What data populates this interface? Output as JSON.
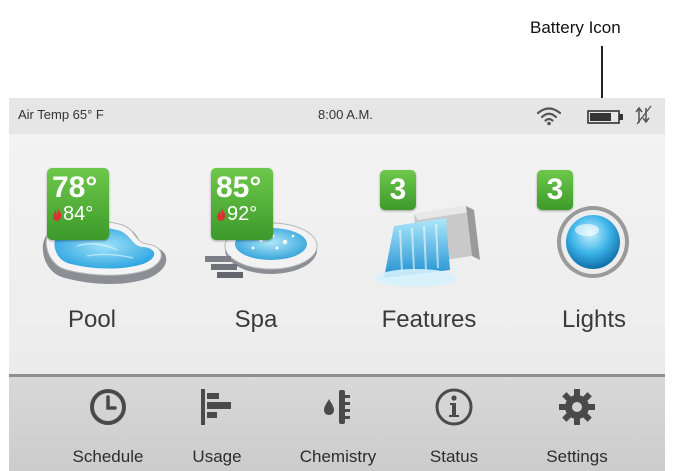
{
  "annotation": {
    "callout": "Battery Icon"
  },
  "statusbar": {
    "air_temp": "Air Temp 65° F",
    "time": "8:00 A.M.",
    "icons": [
      "wifi-icon",
      "battery-icon",
      "signal-icon"
    ]
  },
  "tiles": [
    {
      "label": "Pool",
      "current_temp": "78°",
      "set_temp": "84°",
      "icon": "pool-icon"
    },
    {
      "label": "Spa",
      "current_temp": "85°",
      "set_temp": "92°",
      "icon": "spa-icon"
    },
    {
      "label": "Features",
      "count": "3",
      "icon": "waterfall-icon"
    },
    {
      "label": "Lights",
      "count": "3",
      "icon": "light-bulb-icon"
    }
  ],
  "nav": [
    {
      "label": "Schedule",
      "icon": "clock-icon"
    },
    {
      "label": "Usage",
      "icon": "bar-chart-icon"
    },
    {
      "label": "Chemistry",
      "icon": "thermometer-drop-icon"
    },
    {
      "label": "Status",
      "icon": "info-icon"
    },
    {
      "label": "Settings",
      "icon": "gear-icon"
    }
  ],
  "colors": {
    "badge_green": "#4caf34",
    "flame_red": "#d93434",
    "water_blue": "#3db4e8"
  }
}
